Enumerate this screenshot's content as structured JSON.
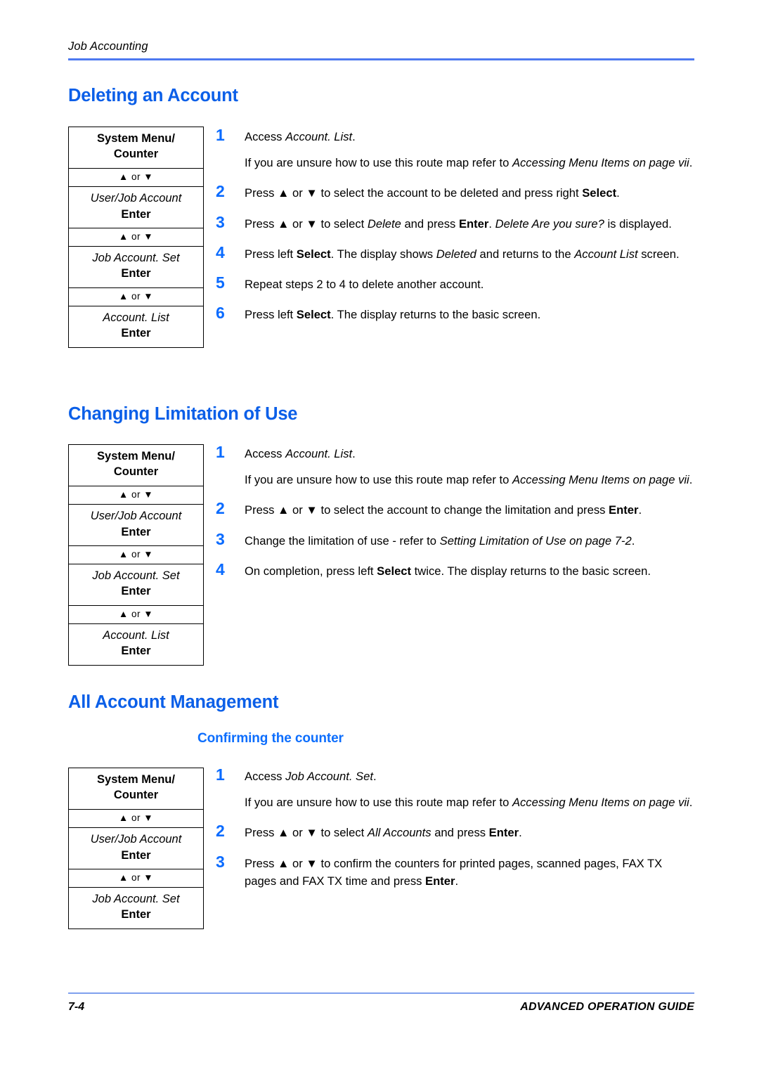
{
  "header": {
    "running_title": "Job Accounting",
    "rule_color": "#4d79f0"
  },
  "colors": {
    "heading_blue": "#0b5fe8",
    "subheading_blue": "#0d6efd",
    "step_number_blue": "#0a6bff",
    "header_rule": "#4d79f0",
    "footer_rule": "#7fa0ee"
  },
  "sections": [
    {
      "heading": "Deleting an Account",
      "routemap": [
        {
          "type": "key",
          "line1": "System Menu/",
          "line2": "Counter"
        },
        {
          "type": "arrow",
          "text": "▲ or ▼"
        },
        {
          "type": "menu",
          "item": "User/Job Account",
          "key": "Enter"
        },
        {
          "type": "arrow",
          "text": "▲ or ▼"
        },
        {
          "type": "menu",
          "item": "Job Account. Set",
          "key": "Enter"
        },
        {
          "type": "arrow",
          "text": "▲ or ▼"
        },
        {
          "type": "menu",
          "item": "Account. List",
          "key": "Enter"
        }
      ],
      "steps": [
        {
          "num": "1",
          "paras": [
            "Access <em>Account. List</em>.",
            "If you are unsure how to use this route map refer to <em>Accessing Menu Items on page vii</em>."
          ]
        },
        {
          "num": "2",
          "paras": [
            "Press ▲ or ▼ to select the account to be deleted and press right <b>Select</b>."
          ]
        },
        {
          "num": "3",
          "paras": [
            "Press ▲ or ▼ to select <em>Delete</em> and press <b>Enter</b>. <em>Delete Are you sure?</em> is displayed."
          ]
        },
        {
          "num": "4",
          "paras": [
            "Press left <b>Select</b>. The display shows <em>Deleted</em> and returns to the <em>Account List</em> screen."
          ]
        },
        {
          "num": "5",
          "paras": [
            "Repeat steps 2 to 4 to delete another account."
          ]
        },
        {
          "num": "6",
          "paras": [
            "Press left <b>Select</b>. The display returns to the basic screen."
          ]
        }
      ]
    },
    {
      "heading": "Changing Limitation of Use",
      "routemap": [
        {
          "type": "key",
          "line1": "System Menu/",
          "line2": "Counter"
        },
        {
          "type": "arrow",
          "text": "▲ or ▼"
        },
        {
          "type": "menu",
          "item": "User/Job Account",
          "key": "Enter"
        },
        {
          "type": "arrow",
          "text": "▲ or ▼"
        },
        {
          "type": "menu",
          "item": "Job Account. Set",
          "key": "Enter"
        },
        {
          "type": "arrow",
          "text": "▲ or ▼"
        },
        {
          "type": "menu",
          "item": "Account. List",
          "key": "Enter"
        }
      ],
      "steps": [
        {
          "num": "1",
          "paras": [
            "Access <em>Account. List</em>.",
            "If you are unsure how to use this route map refer to <em>Accessing Menu Items on page vii</em>."
          ]
        },
        {
          "num": "2",
          "paras": [
            "Press ▲ or ▼ to select the account to change the limitation and press <b>Enter</b>."
          ]
        },
        {
          "num": "3",
          "paras": [
            "Change the limitation of use - refer to <em>Setting Limitation of Use on page 7-2</em>."
          ]
        },
        {
          "num": "4",
          "paras": [
            "On completion, press left <b>Select</b> twice. The display returns to the basic screen."
          ]
        }
      ]
    },
    {
      "heading": "All Account Management",
      "subheading": "Confirming the counter",
      "routemap": [
        {
          "type": "key",
          "line1": "System Menu/",
          "line2": "Counter"
        },
        {
          "type": "arrow",
          "text": "▲ or ▼"
        },
        {
          "type": "menu",
          "item": "User/Job Account",
          "key": "Enter"
        },
        {
          "type": "arrow",
          "text": "▲ or ▼"
        },
        {
          "type": "menu",
          "item": "Job Account. Set",
          "key": "Enter"
        }
      ],
      "steps": [
        {
          "num": "1",
          "paras": [
            "Access <em>Job Account. Set</em>.",
            "If you are unsure how to use this route map refer to <em>Accessing Menu Items on page vii</em>."
          ]
        },
        {
          "num": "2",
          "paras": [
            "Press ▲ or ▼ to select <em>All Accounts</em> and press <b>Enter</b>."
          ]
        },
        {
          "num": "3",
          "paras": [
            "Press ▲ or ▼ to confirm the counters for printed pages, scanned pages, FAX TX pages and FAX TX time and press <b>Enter</b>."
          ]
        }
      ]
    }
  ],
  "footer": {
    "page_number": "7-4",
    "guide_title": "ADVANCED OPERATION GUIDE"
  }
}
